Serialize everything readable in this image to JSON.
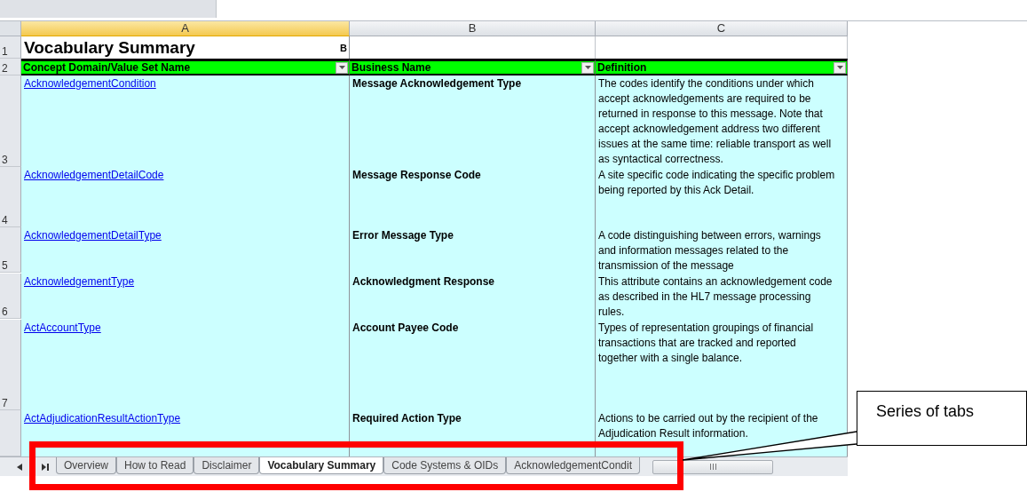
{
  "sheet": {
    "columns": [
      {
        "letter": "A",
        "selected": true
      },
      {
        "letter": "B",
        "selected": false
      },
      {
        "letter": "C",
        "selected": false
      }
    ],
    "title_row": {
      "number": "1",
      "title": "Vocabulary Summary",
      "fragment": "B"
    },
    "header_row": {
      "number": "2",
      "cells": [
        {
          "label": "Concept Domain/Value Set Name",
          "filter": true
        },
        {
          "label": "Business Name",
          "filter": true
        },
        {
          "label": "Definition",
          "filter": true
        }
      ]
    },
    "rows": [
      {
        "number": "3",
        "name": "AcknowledgementCondition",
        "business_name": "Message  Acknowledgement Type",
        "definition": "The codes identify the conditions under which accept acknowledgements are required to be returned in response to this message. Note that accept acknowledgement address two different issues at the same time: reliable transport as well as syntactical correctness."
      },
      {
        "number": "4",
        "name": "AcknowledgementDetailCode",
        "business_name": "Message Response Code",
        "definition": "A site specific code indicating the specific problem being reported by this Ack Detail."
      },
      {
        "number": "5",
        "name": "AcknowledgementDetailType",
        "business_name": "Error Message Type",
        "definition": "A code distinguishing between errors, warnings and information messages related to the transmission of the message"
      },
      {
        "number": "6",
        "name": "AcknowledgementType",
        "business_name": "Acknowledgment Response",
        "definition": "This attribute contains an acknowledgement code as described in the HL7 message processing rules."
      },
      {
        "number": "7",
        "name": "ActAccountType",
        "business_name": "Account Payee Code",
        "definition": "Types of representation groupings of financial transactions that are tracked and reported together with a single balance."
      },
      {
        "name": "ActAdjudicationResultActionType",
        "business_name": "Required Action Type",
        "definition": "Actions to be carried out by the recipient of the Adjudication Result information."
      }
    ]
  },
  "sheet_tabs": [
    {
      "label": "Overview",
      "selected": false
    },
    {
      "label": "How to Read",
      "selected": false
    },
    {
      "label": "Disclaimer",
      "selected": false
    },
    {
      "label": "Vocabulary Summary",
      "selected": true
    },
    {
      "label": "Code Systems & OIDs",
      "selected": false
    },
    {
      "label": "AcknowledgementCondit",
      "selected": false
    }
  ],
  "annotation": {
    "callout": "Series of tabs",
    "highlight": true
  }
}
